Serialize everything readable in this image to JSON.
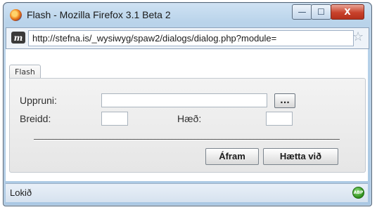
{
  "window": {
    "title": "Flash - Mozilla Firefox 3.1 Beta 2",
    "minimize_glyph": "—",
    "maximize_glyph": "☐",
    "close_glyph": "X"
  },
  "address_bar": {
    "url": "http://stefna.is/_wysiwyg/spaw2/dialogs/dialog.php?module=",
    "site_icon_letter": "m"
  },
  "tabs": [
    {
      "label": "Flash"
    }
  ],
  "form": {
    "source_label": "Uppruni:",
    "source_value": "",
    "browse_label": "...",
    "width_label": "Breidd:",
    "width_value": "",
    "height_label": "Hæð:",
    "height_value": ""
  },
  "buttons": {
    "continue_label": "Áfram",
    "cancel_label": "Hætta við"
  },
  "status": {
    "text": "Lokið",
    "adblock_badge": "ABP"
  },
  "icons": {
    "app": "firefox-icon",
    "site": "site-favicon-icon",
    "bookmark": "star-icon",
    "addon": "adblock-plus-icon"
  },
  "colors": {
    "titlebar": "#b9d3ea",
    "close_button": "#c8422b",
    "panel": "#f3f3f3"
  }
}
